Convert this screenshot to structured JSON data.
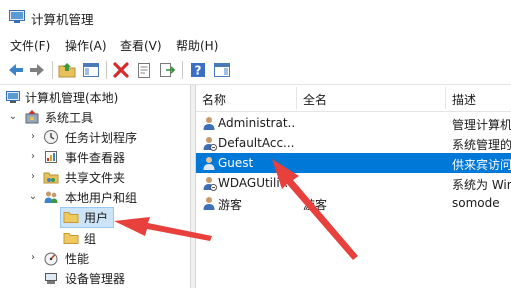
{
  "window": {
    "title": "计算机管理"
  },
  "menu": [
    {
      "label": "文件(F)"
    },
    {
      "label": "操作(A)"
    },
    {
      "label": "查看(V)"
    },
    {
      "label": "帮助(H)"
    }
  ],
  "toolbar": {
    "buttons": [
      {
        "icon": "back-arrow-icon"
      },
      {
        "icon": "forward-arrow-icon"
      },
      {
        "icon": "up-folder-icon"
      },
      {
        "icon": "show-hide-tree-icon"
      },
      {
        "icon": "delete-icon"
      },
      {
        "icon": "properties-icon"
      },
      {
        "icon": "export-list-icon"
      },
      {
        "icon": "help-icon"
      },
      {
        "icon": "action-pane-icon"
      }
    ]
  },
  "tree": {
    "root": "计算机管理(本地)",
    "system_tools": "系统工具",
    "task_scheduler": "任务计划程序",
    "event_viewer": "事件查看器",
    "shared_folders": "共享文件夹",
    "local_users_groups": "本地用户和组",
    "users": "用户",
    "groups": "组",
    "performance": "性能",
    "device_manager": "设备管理器"
  },
  "list": {
    "columns": [
      "名称",
      "全名",
      "描述"
    ],
    "rows": [
      {
        "name": "Administrat...",
        "fullname": "",
        "description": "管理计算机"
      },
      {
        "name": "DefaultAcc...",
        "fullname": "",
        "description": "系统管理的"
      },
      {
        "name": "Guest",
        "fullname": "",
        "description": "供来宾访问"
      },
      {
        "name": "WDAGUtilit...",
        "fullname": "",
        "description": "系统为 Win"
      },
      {
        "name": "游客",
        "fullname": "游客",
        "description": "somode"
      }
    ]
  },
  "colors": {
    "selection": "#0078d7",
    "tree_selection": "#cce4f7",
    "annotation_arrow": "#e8403c"
  }
}
